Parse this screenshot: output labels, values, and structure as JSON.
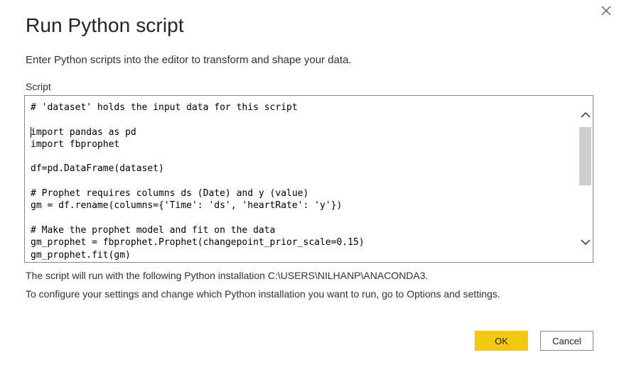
{
  "dialog": {
    "title": "Run Python script",
    "subtitle": "Enter Python scripts into the editor to transform and shape your data.",
    "script_label": "Script",
    "code_lines": [
      "# 'dataset' holds the input data for this script",
      "",
      "import pandas as pd",
      "import fbprophet",
      "",
      "df=pd.DataFrame(dataset)",
      "",
      "# Prophet requires columns ds (Date) and y (value)",
      "gm = df.rename(columns={'Time': 'ds', 'heartRate': 'y'})",
      "",
      "# Make the prophet model and fit on the data",
      "gm_prophet = fbprophet.Prophet(changepoint_prior_scale=0.15)",
      "gm_prophet.fit(gm)"
    ],
    "info_installation": "The script will run with the following Python installation C:\\USERS\\NILHANP\\ANACONDA3.",
    "info_settings": "To configure your settings and change which Python installation you want to run, go to Options and settings.",
    "ok_label": "OK",
    "cancel_label": "Cancel"
  },
  "icons": {
    "close": "close-icon",
    "scroll_up": "chevron-up-icon",
    "scroll_down": "chevron-down-icon"
  },
  "colors": {
    "accent": "#f2c811",
    "border": "#8a8886",
    "scroll_thumb": "#cdcdcd"
  }
}
